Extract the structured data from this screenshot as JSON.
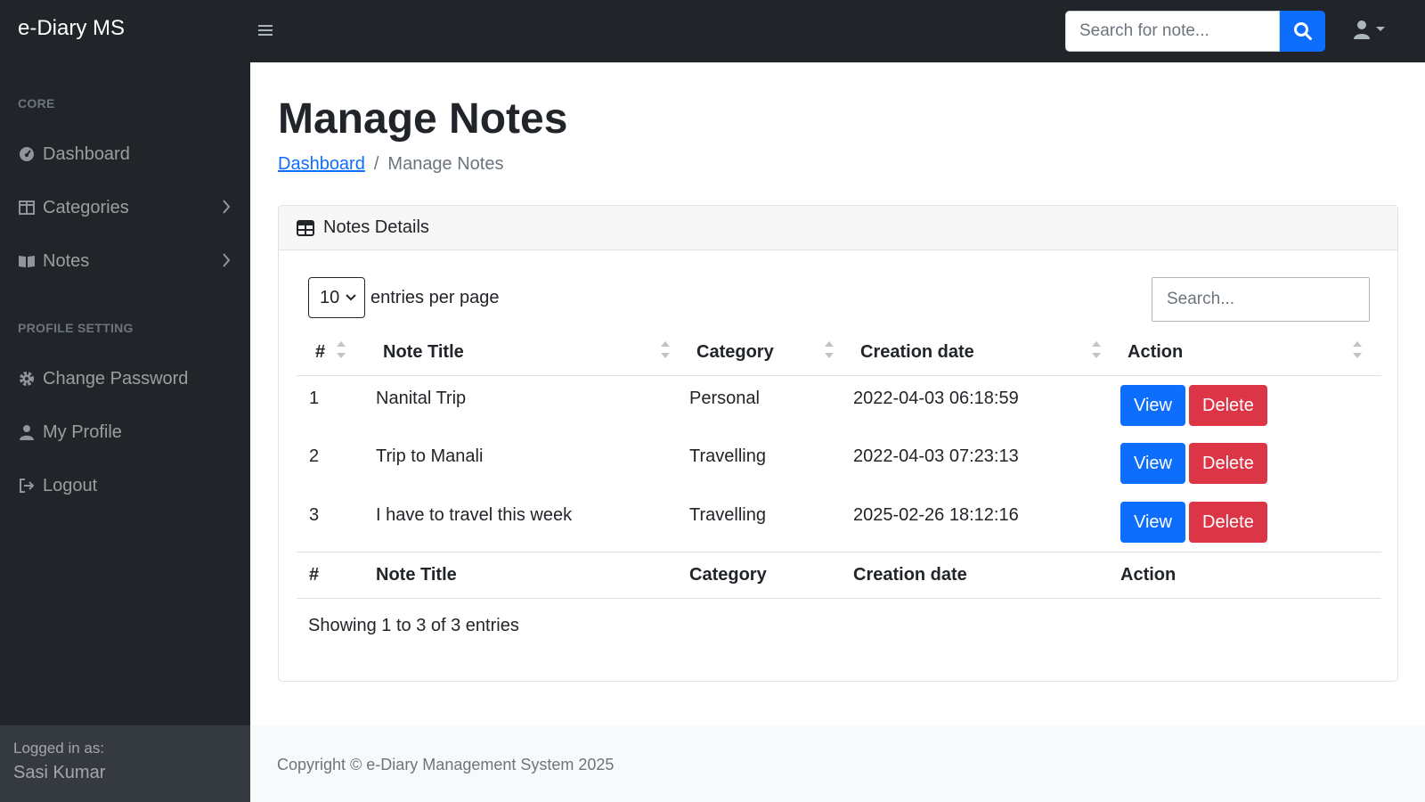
{
  "navbar": {
    "brand": "e-Diary MS",
    "toggle_icon": "hamburger-icon",
    "search_placeholder": "Search for note...",
    "search_icon": "search-icon",
    "user_icon": "user-icon",
    "dark_bg": "#212529",
    "accent": "#0d6efd"
  },
  "sidebar": {
    "headings": [
      "CORE",
      "PROFILE SETTING"
    ],
    "items": [
      {
        "label": "Dashboard",
        "icon": "dashboard-icon"
      },
      {
        "label": "Categories",
        "icon": "columns-icon",
        "has_submenu": true
      },
      {
        "label": "Notes",
        "icon": "book-icon",
        "has_submenu": true
      },
      {
        "label": "Change Password",
        "icon": "gear-icon"
      },
      {
        "label": "My Profile",
        "icon": "user-icon"
      },
      {
        "label": "Logout",
        "icon": "logout-icon"
      }
    ],
    "footer": {
      "label": "Logged in as:",
      "user": "Sasi Kumar"
    }
  },
  "page": {
    "title": "Manage Notes",
    "breadcrumb": {
      "link": "Dashboard",
      "sep": "/",
      "current": "Manage Notes"
    }
  },
  "card": {
    "title": "Notes Details",
    "icon": "table-icon",
    "page_size": "10",
    "entries_label": "entries per page",
    "search_placeholder": "Search...",
    "columns": [
      "#",
      "Note Title",
      "Category",
      "Creation date",
      "Action"
    ],
    "rows": [
      {
        "num": "1",
        "title": "Nanital Trip",
        "category": "Personal",
        "date": "2022-04-03 06:18:59"
      },
      {
        "num": "2",
        "title": "Trip to Manali",
        "category": "Travelling",
        "date": "2022-04-03 07:23:13"
      },
      {
        "num": "3",
        "title": "I have to travel this week",
        "category": "Travelling",
        "date": "2025-02-26 18:12:16"
      }
    ],
    "view_label": "View",
    "delete_label": "Delete",
    "info": "Showing 1 to 3 of 3 entries",
    "colors": {
      "view": "#0d6efd",
      "delete": "#dc3545"
    }
  },
  "footer": {
    "copyright": "Copyright © e-Diary Management System 2025"
  }
}
